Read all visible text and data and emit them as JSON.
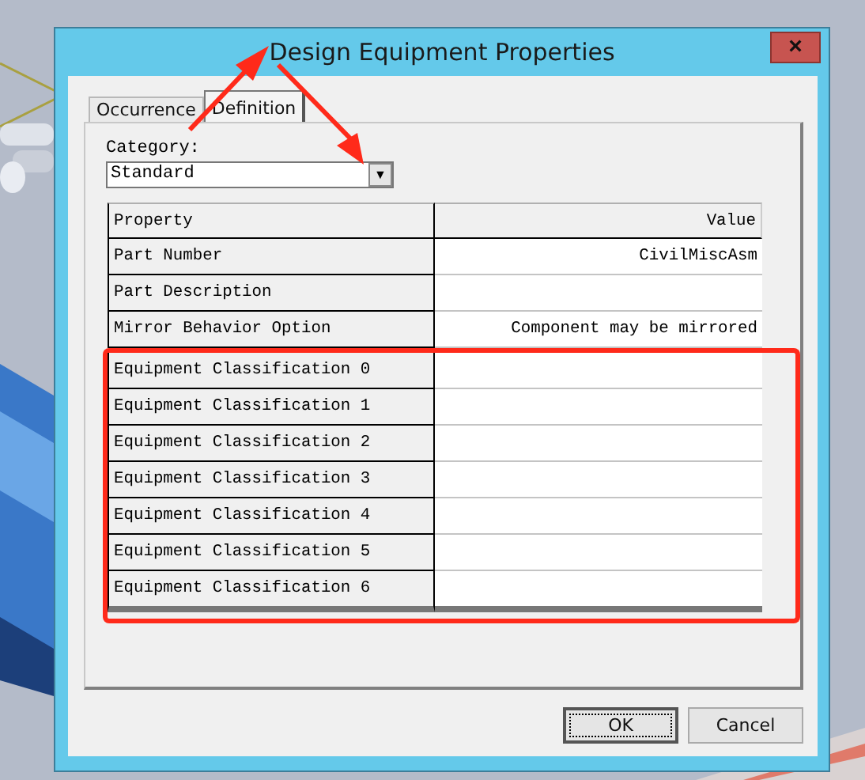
{
  "window": {
    "title": "Design Equipment Properties",
    "close": "×"
  },
  "tabs": [
    {
      "label": "Occurrence",
      "selected": false
    },
    {
      "label": "Definition",
      "selected": true
    }
  ],
  "category": {
    "label": "Category:",
    "value": "Standard",
    "caret": "▼"
  },
  "table": {
    "columns": [
      "Property",
      "Value"
    ],
    "rows": [
      {
        "property": "Part Number",
        "value": "CivilMiscAsm",
        "highlighted": false
      },
      {
        "property": "Part Description",
        "highlighted": false
      },
      {
        "property": "Mirror Behavior Option",
        "value": "Component may be mirrored",
        "highlighted": false
      },
      {
        "property": "Equipment Classification 0",
        "highlighted": true
      },
      {
        "property": "Equipment Classification 1",
        "highlighted": true
      },
      {
        "property": "Equipment Classification 2",
        "highlighted": true
      },
      {
        "property": "Equipment Classification 3",
        "highlighted": true
      },
      {
        "property": "Equipment Classification 4",
        "highlighted": true
      },
      {
        "property": "Equipment Classification 5",
        "highlighted": true
      },
      {
        "property": "Equipment Classification 6",
        "highlighted": true
      }
    ]
  },
  "buttons": [
    {
      "label": "OK",
      "default": true
    },
    {
      "label": "Cancel",
      "default": false
    }
  ]
}
